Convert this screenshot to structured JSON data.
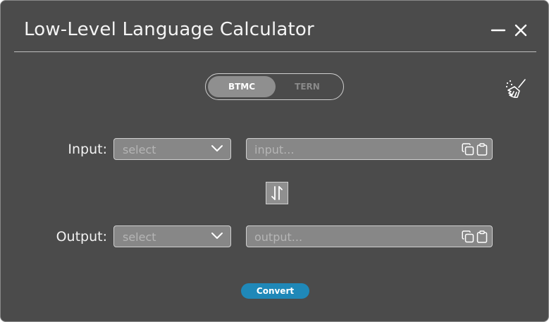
{
  "window": {
    "title": "Low-Level Language Calculator"
  },
  "mode_toggle": {
    "options": [
      "BTMC",
      "TERN"
    ],
    "selected": "BTMC"
  },
  "input_row": {
    "label": "Input:",
    "select_placeholder": "select",
    "text_placeholder": "input..."
  },
  "output_row": {
    "label": "Output:",
    "select_placeholder": "select",
    "text_placeholder": "output..."
  },
  "actions": {
    "convert_label": "Convert"
  },
  "icons": {
    "clear": "broom-icon",
    "swap": "swap-arrows-icon",
    "copy": "copy-icon",
    "paste": "clipboard-icon",
    "minimize": "minimize-icon",
    "close": "close-icon",
    "dropdown": "chevron-down-icon"
  },
  "colors": {
    "window_bg": "#4b4b4b",
    "field_bg": "#878787",
    "accent": "#1f88b8"
  }
}
